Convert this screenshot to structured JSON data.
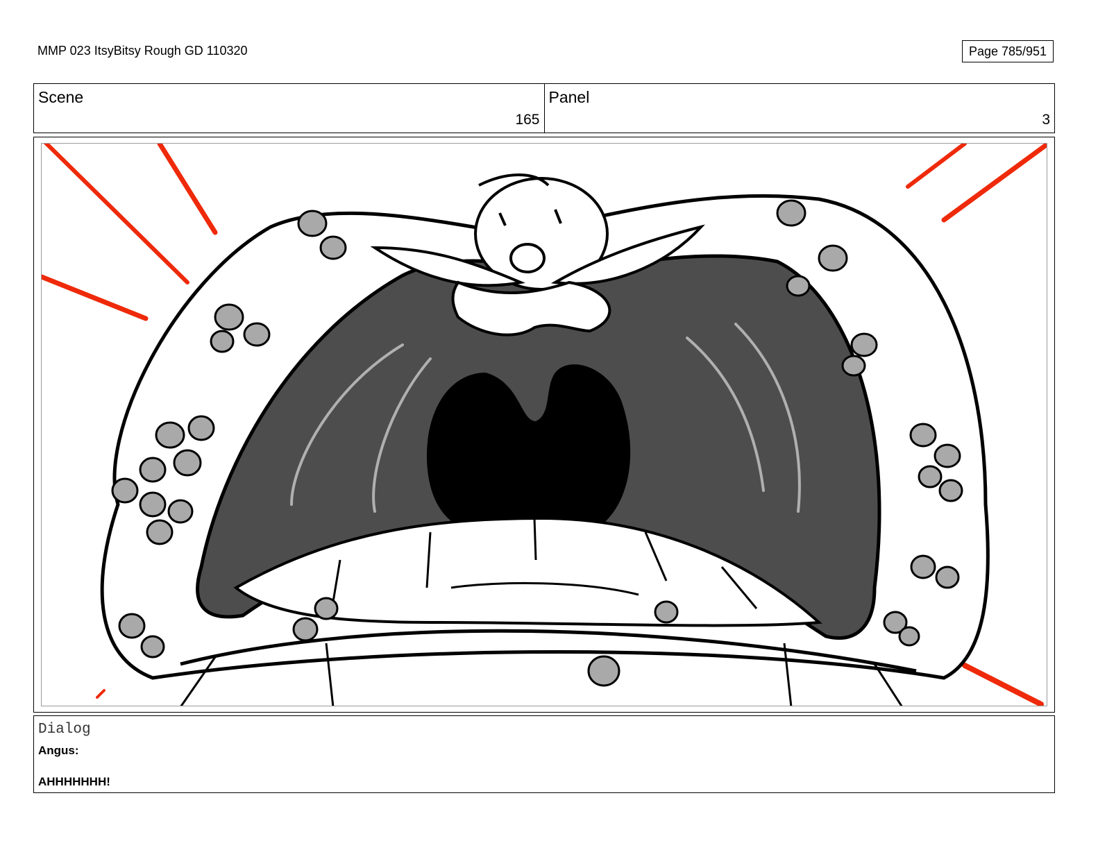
{
  "header": {
    "title": "MMP 023 ItsyBitsy Rough GD 110320",
    "page": "Page 785/951"
  },
  "scene": {
    "label": "Scene",
    "value": "165"
  },
  "panel": {
    "label": "Panel",
    "value": "3"
  },
  "illustration": {
    "description_icon": "screaming-mouth-with-spiders-sketch",
    "accent_color": "#ee2a0a",
    "mouth_color": "#4d4d4d",
    "throat_color": "#000000",
    "spider_color": "#a9a9a9"
  },
  "dialog": {
    "label": "Dialog",
    "speaker": "Angus:",
    "line": "AHHHHHHH!"
  }
}
